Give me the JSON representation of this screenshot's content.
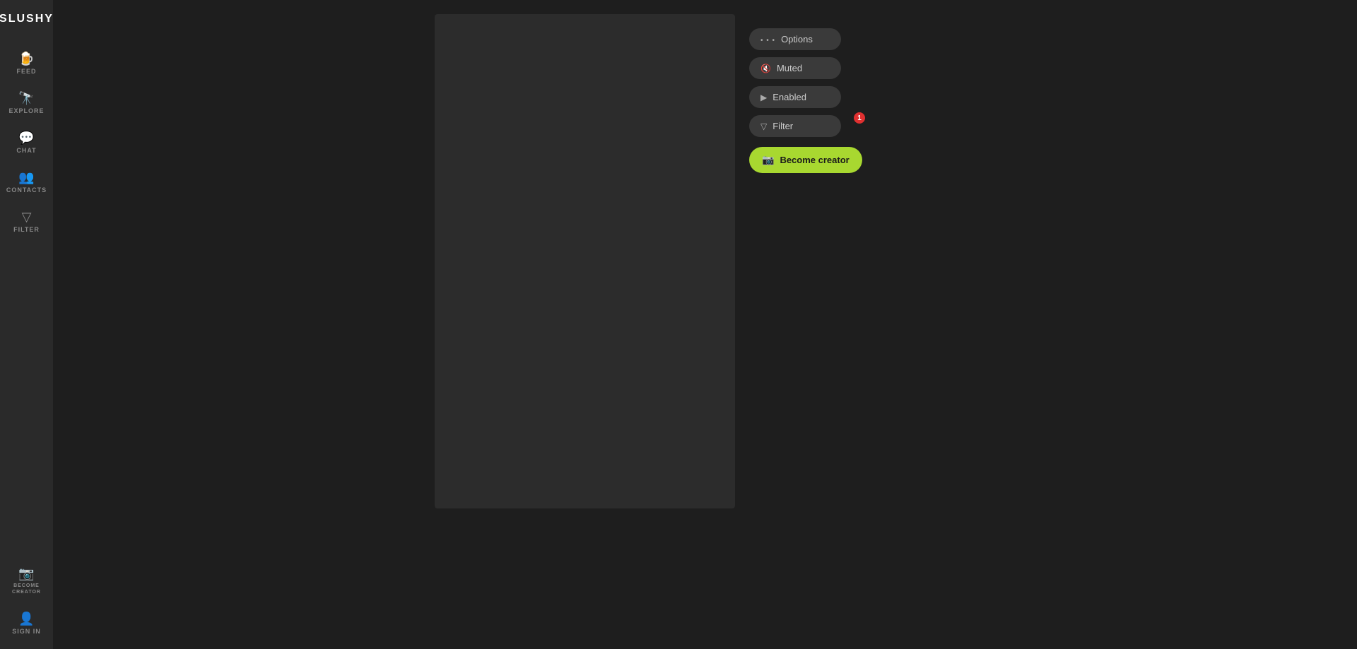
{
  "app": {
    "name": "SLUSHY"
  },
  "sidebar": {
    "items": [
      {
        "id": "feed",
        "label": "FEED",
        "icon": "🍺"
      },
      {
        "id": "explore",
        "label": "EXPLORE",
        "icon": "🔭"
      },
      {
        "id": "chat",
        "label": "CHAT",
        "icon": "💬"
      },
      {
        "id": "contacts",
        "label": "CONTACTS",
        "icon": "👥"
      },
      {
        "id": "filter",
        "label": "FILTER",
        "icon": "▽"
      }
    ],
    "bottom_items": [
      {
        "id": "become-creator",
        "label": "BECOME CREATOR",
        "icon": "📷"
      },
      {
        "id": "sign-in",
        "label": "SIGN IN",
        "icon": "👤"
      }
    ]
  },
  "controls": {
    "options_label": "Options",
    "muted_label": "Muted",
    "enabled_label": "Enabled",
    "filter_label": "Filter",
    "filter_badge": "1",
    "become_creator_label": "Become creator"
  }
}
